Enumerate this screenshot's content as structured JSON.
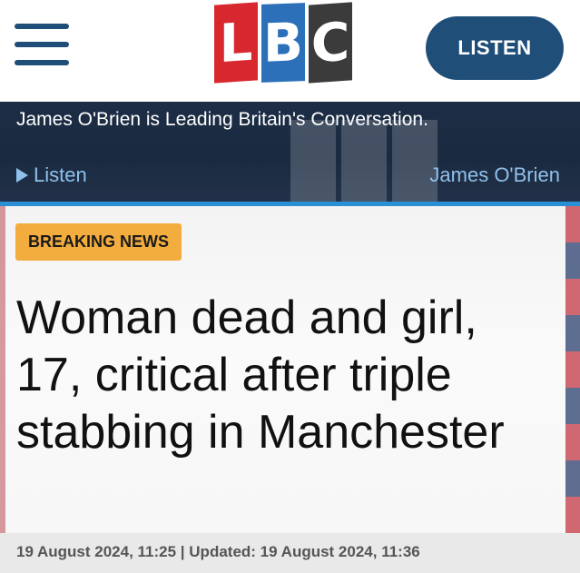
{
  "header": {
    "logo": {
      "letters": [
        "L",
        "B",
        "C"
      ],
      "colors": [
        "#d8282f",
        "#2b70b8",
        "#3b3b3b"
      ]
    },
    "menu_icon": "hamburger-menu-icon",
    "listen_label": "LISTEN"
  },
  "show": {
    "tagline": "James O'Brien is Leading Britain's Conversation.",
    "listen_label": "Listen",
    "presenter": "James O'Brien"
  },
  "article": {
    "badge": "BREAKING NEWS",
    "headline": "Woman dead and girl, 17, critical after triple stabbing in Manchester",
    "meta": "19 August 2024, 11:25 | Updated: 19 August 2024, 11:36"
  },
  "colors": {
    "brand_blue": "#1f4e79",
    "badge_orange": "#f3ad3f",
    "accent_line": "#2b8fd6"
  }
}
